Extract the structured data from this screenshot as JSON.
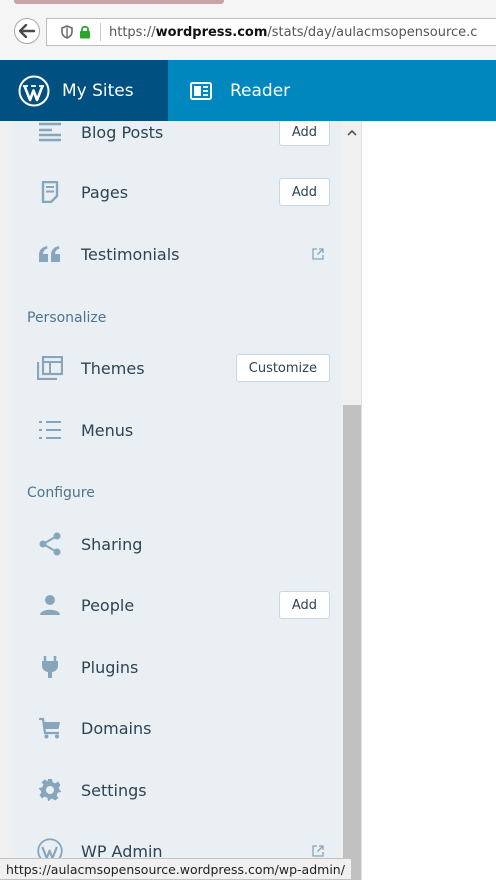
{
  "browser": {
    "url_prefix": "https://",
    "url_domain": "wordpress.com",
    "url_path": "/stats/day/aulacmsopensource.c"
  },
  "masterbar": {
    "my_sites": "My Sites",
    "reader": "Reader",
    "accent": "#0087be",
    "active_bg": "#005082"
  },
  "sidebar": {
    "items_top": [
      {
        "label": "Blog Posts",
        "button": "Add",
        "icon": "posts-icon"
      },
      {
        "label": "Pages",
        "button": "Add",
        "icon": "pages-icon"
      },
      {
        "label": "Testimonials",
        "icon": "quote-icon",
        "external": "external-link-icon"
      }
    ],
    "personalize_heading": "Personalize",
    "personalize_items": [
      {
        "label": "Themes",
        "button": "Customize",
        "icon": "themes-icon"
      },
      {
        "label": "Menus",
        "icon": "menus-icon"
      }
    ],
    "configure_heading": "Configure",
    "configure_items": [
      {
        "label": "Sharing",
        "icon": "share-icon"
      },
      {
        "label": "People",
        "button": "Add",
        "icon": "person-icon"
      },
      {
        "label": "Plugins",
        "icon": "plug-icon"
      },
      {
        "label": "Domains",
        "icon": "cart-icon"
      },
      {
        "label": "Settings",
        "icon": "cog-icon"
      },
      {
        "label": "WP Admin",
        "icon": "wordpress-icon",
        "external": "external-link-icon"
      }
    ]
  },
  "status_bar": {
    "text": "https://aulacmsopensource.wordpress.com/wp-admin/"
  }
}
